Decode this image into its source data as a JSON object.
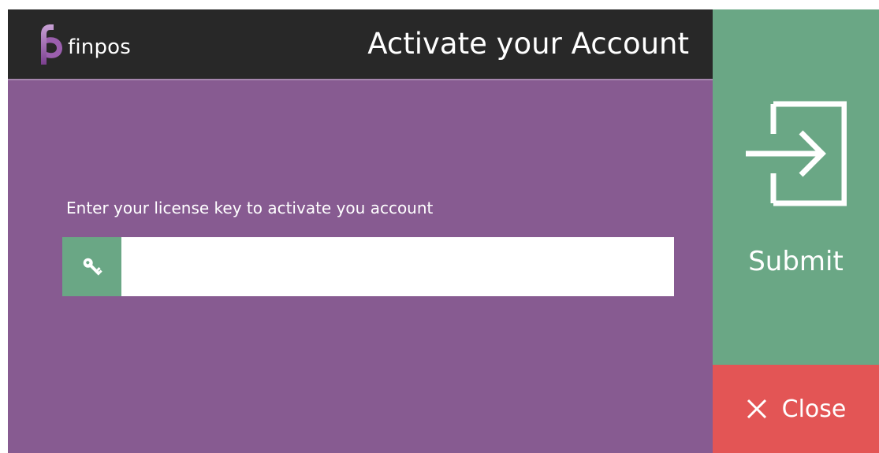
{
  "header": {
    "brand_name": "finpos",
    "title": "Activate your Account"
  },
  "form": {
    "prompt": "Enter your license key to activate you account",
    "license_key_value": "",
    "license_key_placeholder": ""
  },
  "actions": {
    "submit_label": "Submit",
    "close_label": "Close"
  },
  "icons": {
    "logo": "finpos-logo-mark",
    "key": "key-icon",
    "submit": "sign-in-arrow-icon",
    "close": "close-x-icon"
  },
  "colors": {
    "panel_purple": "#875b91",
    "header_dark": "#282828",
    "accent_green": "#6aa785",
    "danger_red": "#e35555"
  }
}
